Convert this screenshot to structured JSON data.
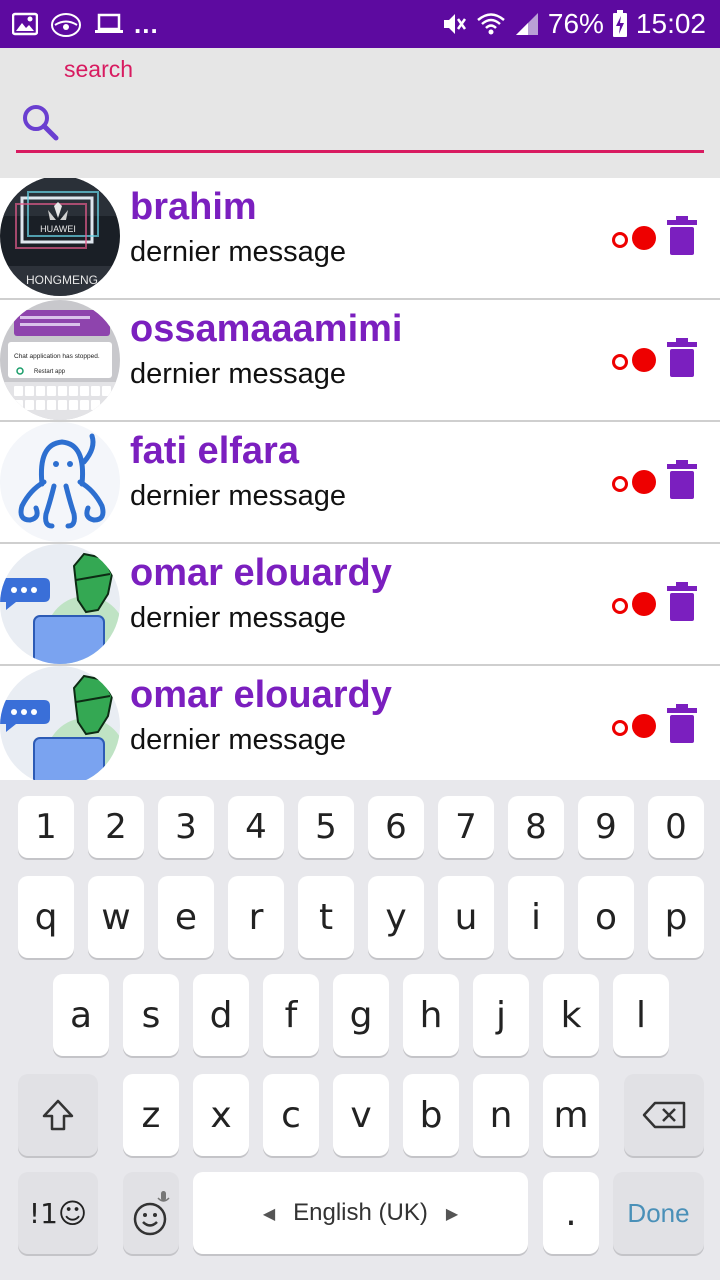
{
  "status_bar": {
    "dots": "...",
    "battery": "76%",
    "time": "15:02"
  },
  "search": {
    "label": "search",
    "value": "",
    "placeholder": ""
  },
  "contacts": [
    {
      "name": "brahim",
      "last_message": "dernier message"
    },
    {
      "name": "ossamaaamimi",
      "last_message": "dernier message"
    },
    {
      "name": "fati elfara",
      "last_message": "dernier message"
    },
    {
      "name": "omar elouardy",
      "last_message": "dernier message"
    },
    {
      "name": "omar elouardy",
      "last_message": "dernier message"
    }
  ],
  "avatar_texts": {
    "huawei": "HUAWEI",
    "hongmeng": "HONGMENG",
    "crash_title": "Chat application has stopped.",
    "crash_action": "Restart app"
  },
  "keyboard": {
    "row_numbers": [
      "1",
      "2",
      "3",
      "4",
      "5",
      "6",
      "7",
      "8",
      "9",
      "0"
    ],
    "row1": [
      "q",
      "w",
      "e",
      "r",
      "t",
      "y",
      "u",
      "i",
      "o",
      "p"
    ],
    "row2": [
      "a",
      "s",
      "d",
      "f",
      "g",
      "h",
      "j",
      "k",
      "l"
    ],
    "row3": [
      "z",
      "x",
      "c",
      "v",
      "b",
      "n",
      "m"
    ],
    "symbols_label": "!1☺",
    "language_label": "English (UK)",
    "period_label": ".",
    "done_label": "Done"
  },
  "colors": {
    "status_bar": "#5d0aa0",
    "accent_purple": "#7b1fbf",
    "accent_pink": "#d81b60",
    "status_red": "#e00000"
  }
}
